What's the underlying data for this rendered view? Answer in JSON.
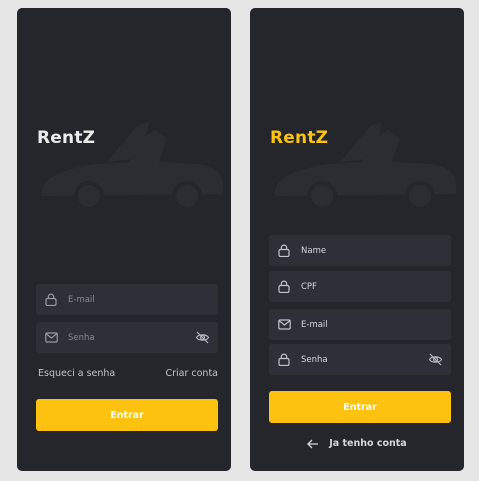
{
  "colors": {
    "background": "#e6e6e6",
    "screen": "#25252c",
    "field": "#2f2f37",
    "accent": "#fdc20f",
    "muted_text": "#8a8a92",
    "icon": "#9a9aa2",
    "car_silhouette": "#2c2c33"
  },
  "login": {
    "brand": "RentZ",
    "email_placeholder": "E-mail",
    "email_icon": "lock-icon",
    "password_placeholder": "Senha",
    "password_icon": "mail-icon",
    "toggle_icon": "eye-off-icon",
    "forgot_link": "Esqueci a senha",
    "create_link": "Criar conta",
    "submit_label": "Entrar"
  },
  "signup": {
    "brand": "RentZ",
    "fields": [
      {
        "placeholder": "Name",
        "icon": "lock-icon"
      },
      {
        "placeholder": "CPF",
        "icon": "lock-icon"
      },
      {
        "placeholder": "E-mail",
        "icon": "mail-icon"
      },
      {
        "placeholder": "Senha",
        "icon": "lock-icon"
      }
    ],
    "toggle_icon": "eye-off-icon",
    "submit_label": "Entrar",
    "back_label": "Ja tenho conta",
    "back_icon": "arrow-left-icon"
  }
}
